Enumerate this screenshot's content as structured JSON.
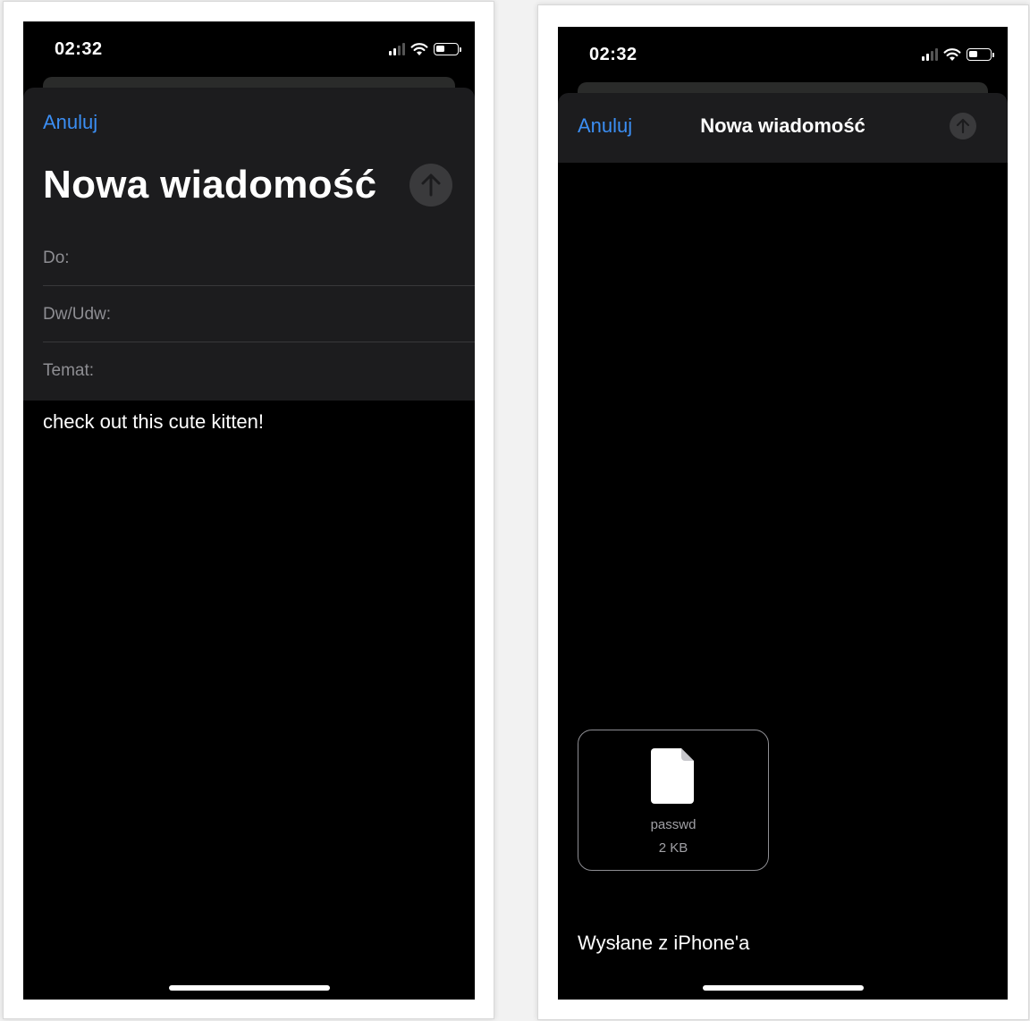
{
  "left_screen": {
    "status": {
      "time": "02:32"
    },
    "cancel_label": "Anuluj",
    "title": "Nowa wiadomość",
    "fields": {
      "to_label": "Do:",
      "cc_label": "Dw/Udw:",
      "subject_label": "Temat:"
    },
    "body": "check out this cute kitten!"
  },
  "right_screen": {
    "status": {
      "time": "02:32"
    },
    "cancel_label": "Anuluj",
    "title": "Nowa wiadomość",
    "attachment": {
      "name": "passwd",
      "size": "2 KB"
    },
    "signature": "Wysłane z iPhone'a"
  },
  "colors": {
    "accent": "#3b8ef3",
    "sheet": "#1c1c1e",
    "background": "#000000"
  },
  "icons": [
    "signal-icon",
    "wifi-icon",
    "battery-icon",
    "send-arrow-icon",
    "document-icon"
  ]
}
